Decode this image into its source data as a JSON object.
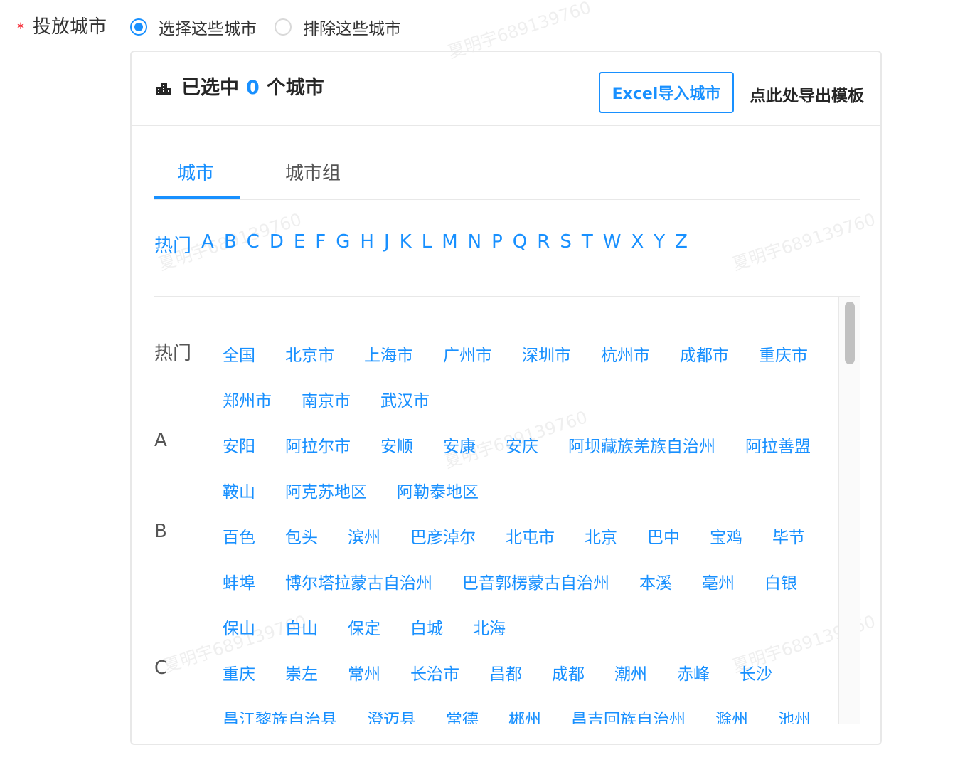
{
  "form": {
    "required_mark": "*",
    "label": "投放城市",
    "options": [
      {
        "label": "选择这些城市",
        "checked": true
      },
      {
        "label": "排除这些城市",
        "checked": false
      }
    ]
  },
  "header": {
    "icon": "buildings-icon",
    "prefix": "已选中",
    "count": "0",
    "suffix": "个城市",
    "excel_button": "Excel导入城市",
    "export_link": "点此处导出模板"
  },
  "tabs": [
    {
      "label": "城市",
      "active": true
    },
    {
      "label": "城市组",
      "active": false
    }
  ],
  "index_letters": [
    "热门",
    "A",
    "B",
    "C",
    "D",
    "E",
    "F",
    "G",
    "H",
    "J",
    "K",
    "L",
    "M",
    "N",
    "P",
    "Q",
    "R",
    "S",
    "T",
    "W",
    "X",
    "Y",
    "Z"
  ],
  "groups": [
    {
      "letter": "热门",
      "cities": [
        "全国",
        "北京市",
        "上海市",
        "广州市",
        "深圳市",
        "杭州市",
        "成都市",
        "重庆市",
        "郑州市",
        "南京市",
        "武汉市"
      ]
    },
    {
      "letter": "A",
      "cities": [
        "安阳",
        "阿拉尔市",
        "安顺",
        "安康",
        "安庆",
        "阿坝藏族羌族自治州",
        "阿拉善盟",
        "鞍山",
        "阿克苏地区",
        "阿勒泰地区"
      ]
    },
    {
      "letter": "B",
      "cities": [
        "百色",
        "包头",
        "滨州",
        "巴彦淖尔",
        "北屯市",
        "北京",
        "巴中",
        "宝鸡",
        "毕节",
        "蚌埠",
        "博尔塔拉蒙古自治州",
        "巴音郭楞蒙古自治州",
        "本溪",
        "亳州",
        "白银",
        "保山",
        "白山",
        "保定",
        "白城",
        "北海"
      ]
    },
    {
      "letter": "C",
      "cities": [
        "重庆",
        "崇左",
        "常州",
        "长治市",
        "昌都",
        "成都",
        "潮州",
        "赤峰",
        "长沙",
        "昌江黎族自治县",
        "澄迈县",
        "常德",
        "郴州",
        "昌吉回族自治州",
        "滁州",
        "池州"
      ]
    }
  ],
  "watermark": "夏明宇689139760",
  "colors": {
    "primary": "#1890ff",
    "required": "#f5222d",
    "border": "#e8e8e8"
  }
}
